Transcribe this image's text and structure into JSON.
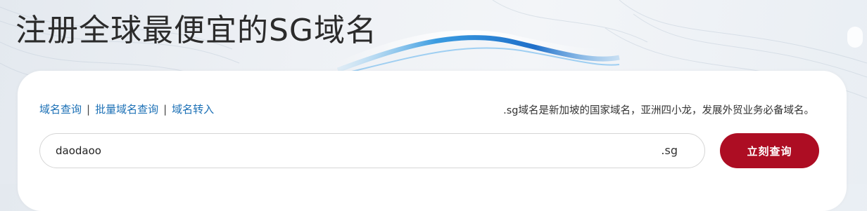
{
  "hero": {
    "title": "注册全球最便宜的SG域名"
  },
  "nav": {
    "links": [
      "域名查询",
      "批量域名查询",
      "域名转入"
    ],
    "separator": "|"
  },
  "tagline": ".sg域名是新加坡的国家域名，亚洲四小龙，发展外贸业务必备域名。",
  "search": {
    "value": "daodaoo",
    "suffix": ".sg",
    "button_label": "立刻查询"
  },
  "colors": {
    "accent_button": "#ad0d23",
    "link": "#1a6fb5",
    "title": "#2b2b2b"
  }
}
